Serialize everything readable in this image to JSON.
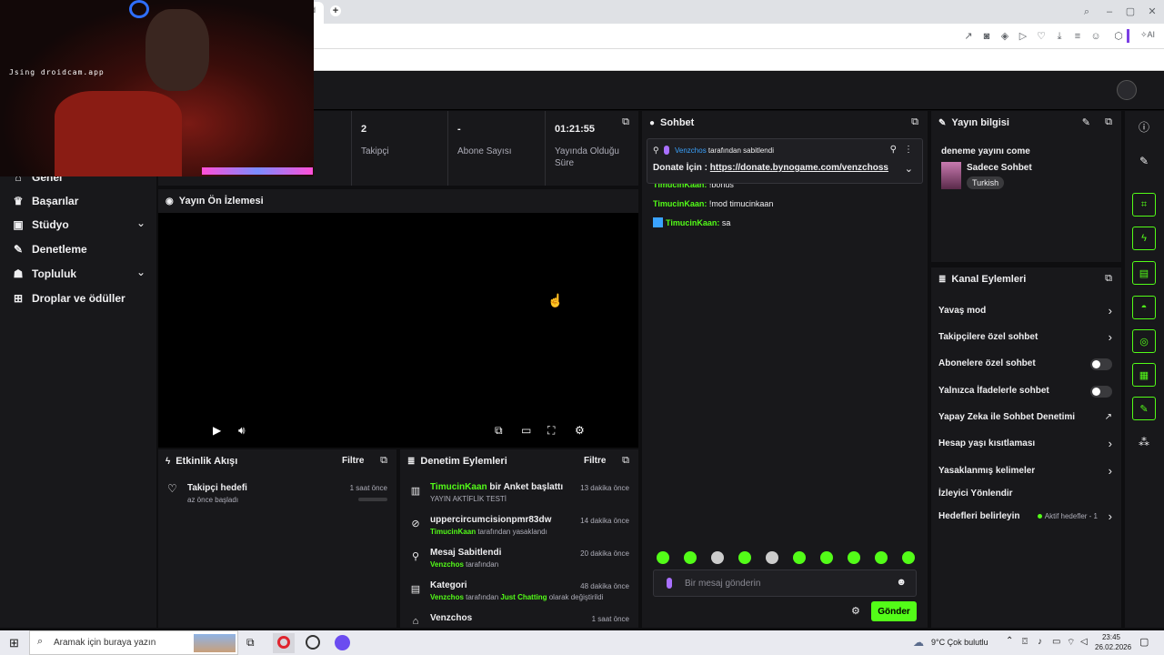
{
  "browser": {
    "ai_label": "AI"
  },
  "webcam": {
    "watermark": "Jsing droidcam.app"
  },
  "sidebar": {
    "items": [
      {
        "label": "Genel",
        "icon": "home-icon"
      },
      {
        "label": "Başarılar",
        "icon": "trophy-icon"
      },
      {
        "label": "Stüdyo",
        "icon": "studio-icon"
      },
      {
        "label": "Denetleme",
        "icon": "wrench-icon"
      },
      {
        "label": "Topluluk",
        "icon": "community-icon"
      },
      {
        "label": "Droplar ve ödüller",
        "icon": "gift-icon"
      }
    ]
  },
  "stats": [
    {
      "value": "2",
      "label": "Takipçi"
    },
    {
      "value": "-",
      "label": "Abone Sayısı"
    },
    {
      "value": "01:21:55",
      "label": "Yayında Olduğu Süre"
    }
  ],
  "preview": {
    "title": "Yayın Ön İzlemesi"
  },
  "activity": {
    "title": "Etkinlik Akışı",
    "filter": "Filtre",
    "items": [
      {
        "title": "Takipçi hedefi",
        "sub": "az önce başladı",
        "time": "1 saat önce",
        "progress": 0
      }
    ]
  },
  "moderation": {
    "title": "Denetim Eylemleri",
    "filter": "Filtre",
    "items": [
      {
        "user": "TimucinKaan",
        "text": " bir Anket başlattı",
        "sub": "YAYIN AKTİFLİK TESTİ",
        "time": "13 dakika önce"
      },
      {
        "user": "",
        "text": "uppercircumcisionpmr83dw",
        "sub_user": "TimucinKaan",
        "sub": " tarafından yasaklandı",
        "time": "14 dakika önce"
      },
      {
        "user": "",
        "text": "Mesaj Sabitlendi",
        "sub_user": "Venzchos",
        "sub": " tarafından",
        "time": "20 dakika önce"
      },
      {
        "user": "",
        "text": "Kategori",
        "sub_user": "Venzchos",
        "sub": " tarafından ",
        "sub_green": "Just Chatting",
        "sub_tail": " olarak değiştirildi",
        "time": "48 dakika önce"
      },
      {
        "user": "",
        "text": "Venzchos",
        "time": "1 saat önce"
      }
    ]
  },
  "chat": {
    "title": "Sohbet",
    "pinned_by_user": "Venzchos",
    "pinned_by_text": " tarafından sabitlendi",
    "pinned_label": "Donate İçin : ",
    "pinned_link": "https://donate.bynogame.com/venzchoss",
    "partial_line_user": "TimucinKaan:",
    "partial_line_text": " !bonus",
    "messages": [
      {
        "user": "TimucinKaan:",
        "text": " !mod timucinkaan"
      },
      {
        "user": "TimucinKaan:",
        "text": " sa"
      }
    ],
    "input_placeholder": "Bir mesaj gönderin",
    "send_label": "Gönder"
  },
  "stream_info": {
    "title": "Yayın bilgisi",
    "stream_title": "deneme yayını come",
    "category": "Sadece Sohbet",
    "language": "Turkish"
  },
  "channel_actions": {
    "title": "Kanal Eylemleri",
    "items": [
      {
        "label": "Yavaş mod",
        "control": "chevron"
      },
      {
        "label": "Takipçilere özel sohbet",
        "control": "chevron"
      },
      {
        "label": "Abonelere özel sohbet",
        "control": "toggle",
        "value": false
      },
      {
        "label": "Yalnızca İfadelerle sohbet",
        "control": "toggle",
        "value": false
      },
      {
        "label": "Yapay Zeka ile Sohbet Denetimi",
        "control": "external"
      },
      {
        "label": "Hesap yaşı kısıtlaması",
        "control": "chevron"
      },
      {
        "label": "Yasaklanmış kelimeler",
        "control": "chevron"
      },
      {
        "label": "İzleyici Yönlendir",
        "control": "none"
      },
      {
        "label": "Hedefleri belirleyin",
        "control": "chevron",
        "badge": "Aktif hedefler - 1"
      }
    ]
  },
  "taskbar": {
    "search_placeholder": "Aramak için buraya yazın",
    "weather": "9°C  Çok bulutlu",
    "time": "23:45",
    "date": "26.02.2026"
  },
  "colors": {
    "accent": "#53fc18",
    "panel": "#18181b",
    "background": "#0e0e10"
  }
}
